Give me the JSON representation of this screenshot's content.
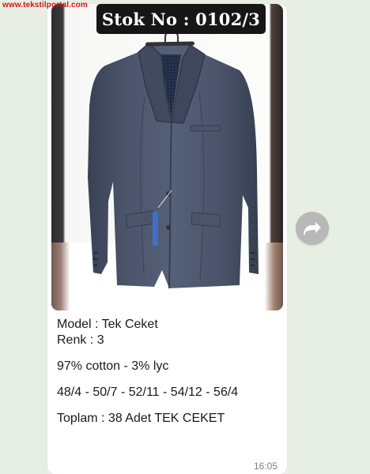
{
  "watermark": "www.tekstilportal.com",
  "message": {
    "stock_label": "Stok No : 0102/3",
    "lines": [
      "Model : Tek Ceket",
      "Renk : 3",
      "97% cotton - 3% lyc",
      "48/4 - 50/7 - 52/11 - 54/12 - 56/4",
      "Toplam :  38 Adet TEK CEKET"
    ],
    "timestamp": "16:05"
  },
  "icons": {
    "forward": "forward-arrow-icon"
  },
  "colors": {
    "bubble_background": "#ffffff",
    "chat_background": "#e7efe4",
    "watermark": "#d81616",
    "tag_background": "#161616",
    "jacket_base": "#485166"
  }
}
